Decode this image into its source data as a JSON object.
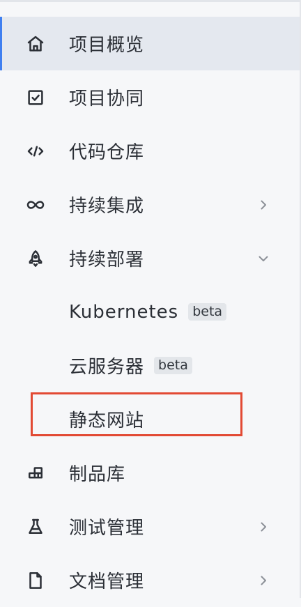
{
  "menu": {
    "items": [
      {
        "label": "项目概览",
        "icon": "home-icon",
        "active": true
      },
      {
        "label": "项目协同",
        "icon": "checkbox-icon"
      },
      {
        "label": "代码仓库",
        "icon": "code-icon"
      },
      {
        "label": "持续集成",
        "icon": "infinity-icon",
        "chevron": "right"
      },
      {
        "label": "持续部署",
        "icon": "rocket-icon",
        "chevron": "down"
      },
      {
        "label": "Kubernetes",
        "badge": "beta",
        "sub": true
      },
      {
        "label": "云服务器",
        "badge": "beta",
        "sub": true
      },
      {
        "label": "静态网站",
        "sub": true,
        "highlighted": true
      },
      {
        "label": "制品库",
        "icon": "artifact-icon"
      },
      {
        "label": "测试管理",
        "icon": "flask-icon",
        "chevron": "right"
      },
      {
        "label": "文档管理",
        "icon": "document-icon",
        "chevron": "right"
      }
    ]
  },
  "colors": {
    "active_bg": "#e4e8ef",
    "active_indicator": "#3f7ff0",
    "highlight_border": "#e24a34",
    "text": "#2b2f36"
  }
}
